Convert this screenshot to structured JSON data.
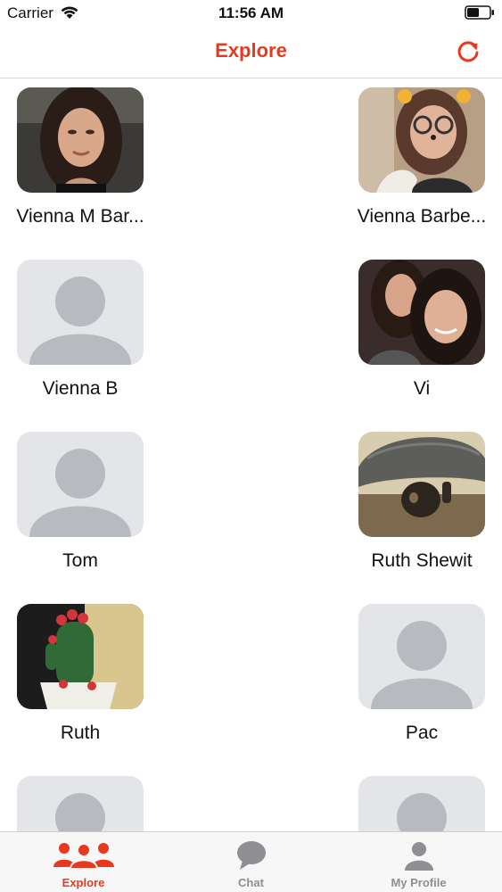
{
  "status_bar": {
    "carrier": "Carrier",
    "time": "11:56 AM"
  },
  "nav": {
    "title": "Explore",
    "accent_color": "#e8391f"
  },
  "profiles": [
    {
      "name": "Vienna M Bar...",
      "photo": "woman-portrait"
    },
    {
      "name": "Vienna Barbe...",
      "photo": "woman-with-glasses"
    },
    {
      "name": "Vienna B",
      "photo": "placeholder"
    },
    {
      "name": "Vi",
      "photo": "two-women-selfie"
    },
    {
      "name": "Tom",
      "photo": "placeholder"
    },
    {
      "name": "Ruth Shewit",
      "photo": "turtle"
    },
    {
      "name": "Ruth",
      "photo": "cactus-plant"
    },
    {
      "name": "Pac",
      "photo": "placeholder"
    },
    {
      "name": "",
      "photo": "placeholder"
    },
    {
      "name": "",
      "photo": "placeholder"
    }
  ],
  "tabs": [
    {
      "label": "Explore",
      "icon": "group-icon",
      "active": true
    },
    {
      "label": "Chat",
      "icon": "chat-bubble-icon",
      "active": false
    },
    {
      "label": "My Profile",
      "icon": "person-icon",
      "active": false
    }
  ],
  "colors": {
    "accent": "#e8391f",
    "inactive_tab": "#8e8e93",
    "placeholder_bg": "#e3e5e8",
    "placeholder_fg": "#b7babe"
  }
}
